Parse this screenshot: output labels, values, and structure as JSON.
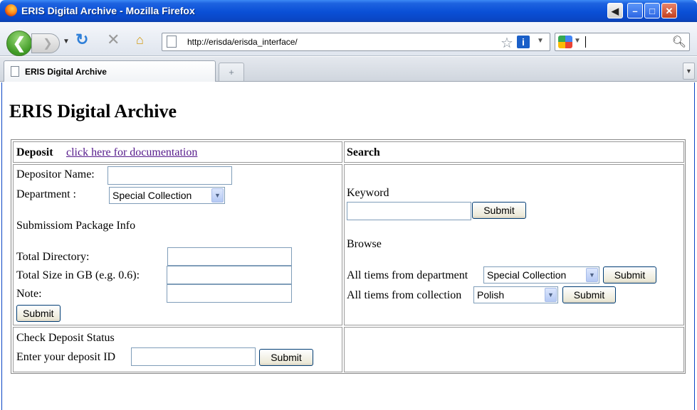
{
  "window": {
    "title": "ERIS Digital Archive - Mozilla Firefox"
  },
  "browser": {
    "url": "http://erisda/erisda_interface/",
    "tab_title": "ERIS Digital Archive",
    "newtab_glyph": "+",
    "icons": {
      "back": "back-arrow-icon",
      "forward": "forward-arrow-icon",
      "reload": "reload-icon",
      "stop": "stop-icon",
      "home": "home-icon",
      "bookmark": "star-icon",
      "search": "magnifier-icon"
    }
  },
  "page": {
    "title": "ERIS Digital Archive",
    "deposit": {
      "heading": "Deposit",
      "doc_link": "click here for documentation",
      "depositor_label": "Depositor Name:",
      "depositor_value": "",
      "department_label": "Department :",
      "department_selected": "Special Collection",
      "package_heading": "Submissiom Package Info",
      "total_directory_label": "Total Directory:",
      "total_size_label": "Total Size in GB (e.g. 0.6):",
      "note_label": "Note:",
      "submit_label": "Submit"
    },
    "search": {
      "heading": "Search",
      "keyword_label": "Keyword",
      "keyword_value": "",
      "submit_label": "Submit",
      "browse_heading": "Browse",
      "dept_label": "All tiems from department",
      "dept_selected": "Special Collection",
      "coll_label": "All tiems from collection",
      "coll_selected": "Polish"
    },
    "status": {
      "heading": "Check Deposit Status",
      "id_label": "Enter your deposit ID",
      "id_value": "",
      "submit_label": "Submit"
    }
  }
}
